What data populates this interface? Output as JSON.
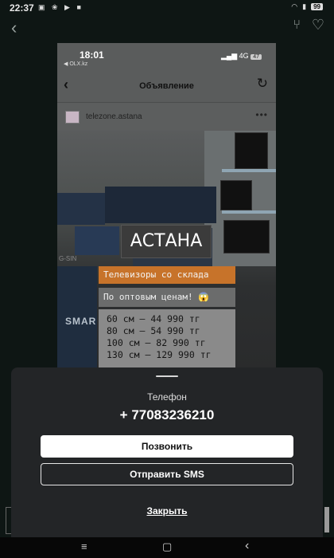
{
  "status_bar": {
    "time": "22:37",
    "notif_icons": "▣ ❀ ▶ ■",
    "battery": "99"
  },
  "ad_photo": {
    "status": {
      "time": "18:01",
      "source": "◀ OLX.kz",
      "network": "4G",
      "battery": "47"
    },
    "nav": {
      "title": "Объявление"
    },
    "seller": {
      "name": "telezone.astana",
      "more": "•••"
    },
    "signs": {
      "city": "АСТАНА",
      "tagline": "Телевизоры со склада",
      "wholesale": "По оптовым ценам! 😱",
      "prices": [
        "60 см — 44 990 тг",
        "80 см — 54 990 тг",
        "100 см — 82 990 тг",
        "130 см — 129 990 тг"
      ],
      "brand_left": "SMAR",
      "brand_small": "G-SIN"
    }
  },
  "sheet": {
    "label": "Телефон",
    "phone": "+ 77083236210",
    "call_button": "Позвонить",
    "sms_button": "Отправить SMS",
    "close_link": "Закрыть"
  },
  "navbar": {
    "menu": "≡",
    "home": "▢",
    "back": "‹"
  },
  "colors": {
    "background": "#0e1614",
    "sheet": "#232527",
    "accent_orange": "#c7732a"
  }
}
